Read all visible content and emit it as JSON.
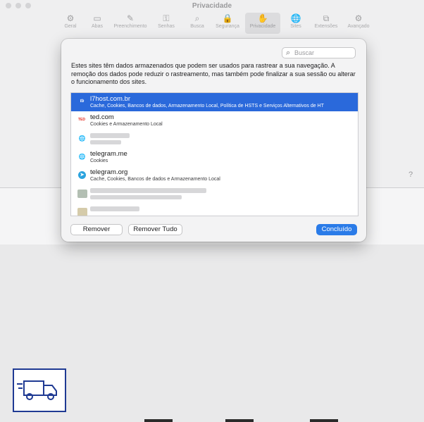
{
  "window": {
    "title": "Privacidade"
  },
  "toolbar": {
    "items": [
      {
        "label": "Geral",
        "icon": "gear-icon",
        "glyph": "⚙"
      },
      {
        "label": "Abas",
        "icon": "tabs-icon",
        "glyph": "▭"
      },
      {
        "label": "Preenchimento",
        "icon": "autofill-icon",
        "glyph": "✎"
      },
      {
        "label": "Senhas",
        "icon": "key-icon",
        "glyph": "⚿"
      },
      {
        "label": "Busca",
        "icon": "search-icon",
        "glyph": "⌕"
      },
      {
        "label": "Segurança",
        "icon": "lock-icon",
        "glyph": "🔒"
      },
      {
        "label": "Privacidade",
        "icon": "hand-icon",
        "glyph": "✋",
        "active": true
      },
      {
        "label": "Sites",
        "icon": "globe-icon",
        "glyph": "🌐"
      },
      {
        "label": "Extensões",
        "icon": "extensions-icon",
        "glyph": "⧉"
      },
      {
        "label": "Avançado",
        "icon": "advanced-gear-icon",
        "glyph": "⚙"
      }
    ]
  },
  "dialog": {
    "search_placeholder": "Buscar",
    "description": "Estes sites têm dados armazenados que podem ser usados para rastrear a sua navegação. A remoção dos dados pode reduzir o rastreamento, mas também pode finalizar a sua sessão ou alterar o funcionamento dos sites.",
    "sites": [
      {
        "name": "l7host.com.br",
        "detail": "Cache, Cookies, Bancos de dados, Armazenamento Local, Política de HSTS e Serviços Alternativos de HT",
        "selected": true,
        "favicon": "l7host-favicon",
        "glyph": "tb",
        "color": "#ffffff"
      },
      {
        "name": "ted.com",
        "detail": "Cookies e Armazenamento Local",
        "favicon": "ted-favicon",
        "glyph": "TED",
        "color": "#e62b1e"
      },
      {
        "name": "",
        "detail": "",
        "favicon": "globe-icon",
        "glyph": "🌐",
        "blurred": true
      },
      {
        "name": "telegram.me",
        "detail": "Cookies",
        "favicon": "globe-icon",
        "glyph": "🌐"
      },
      {
        "name": "telegram.org",
        "detail": "Cache, Cookies, Bancos de dados e Armazenamento Local",
        "favicon": "telegram-favicon",
        "glyph": "➤",
        "color": "#2ba3de"
      },
      {
        "name": "",
        "detail": "",
        "favicon": "blurred-favicon",
        "glyph": "",
        "blurred": true
      },
      {
        "name": "",
        "detail": "",
        "favicon": "blurred-favicon",
        "glyph": "",
        "blurred": true
      }
    ],
    "buttons": {
      "remove": "Remover",
      "remove_all": "Remover Tudo",
      "done": "Concluído"
    }
  },
  "colors": {
    "accent": "#2a69db",
    "primary_button": "#2a7be8"
  }
}
